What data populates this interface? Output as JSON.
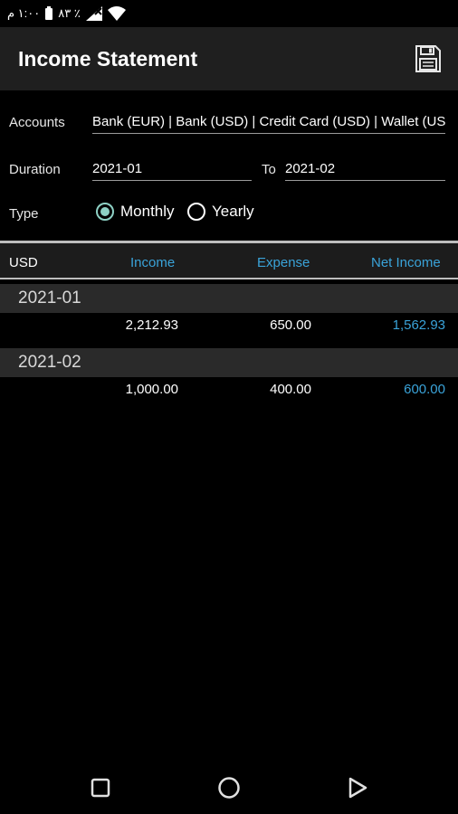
{
  "status_bar": {
    "time": "١:٠٠ م",
    "battery_percent": "٨٣ ٪"
  },
  "appbar": {
    "title": "Income Statement",
    "save_icon": "floppy-disk-icon"
  },
  "form": {
    "accounts_label": "Accounts",
    "accounts_value": "Bank (EUR) | Bank (USD) | Credit Card (USD) | Wallet (USD)",
    "duration_label": "Duration",
    "duration_from": "2021-01",
    "to_label": "To",
    "duration_to": "2021-02",
    "type_label": "Type",
    "type_options": [
      {
        "label": "Monthly",
        "selected": true
      },
      {
        "label": "Yearly",
        "selected": false
      }
    ]
  },
  "table": {
    "headers": [
      "USD",
      "Income",
      "Expense",
      "Net Income"
    ],
    "groups": [
      {
        "period": "2021-01",
        "income": "2,212.93",
        "expense": "650.00",
        "net_income": "1,562.93"
      },
      {
        "period": "2021-02",
        "income": "1,000.00",
        "expense": "400.00",
        "net_income": "600.00"
      }
    ]
  },
  "colors": {
    "accent_blue": "#3aa3d9",
    "radio_teal": "#8ed1c5",
    "appbar_bg": "#1f1f1f"
  },
  "navbar": {
    "icons": [
      "recents-square-icon",
      "home-circle-icon",
      "back-triangle-icon"
    ]
  }
}
